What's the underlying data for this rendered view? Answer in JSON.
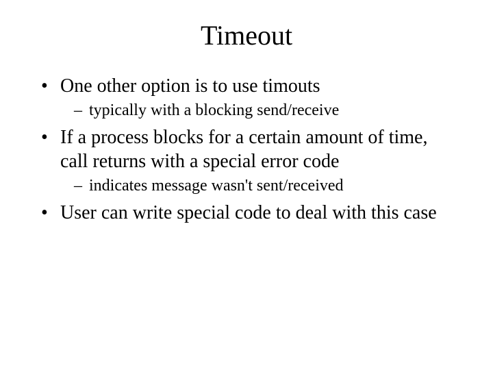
{
  "title": "Timeout",
  "bullets": [
    {
      "text": "One other option is to use timouts",
      "sub": [
        "typically with a blocking send/receive"
      ]
    },
    {
      "text": "If a process blocks for a certain amount of time, call returns with a special error code",
      "sub": [
        "indicates message wasn't sent/received"
      ]
    },
    {
      "text": "User can write special code to deal with this case",
      "sub": []
    }
  ]
}
